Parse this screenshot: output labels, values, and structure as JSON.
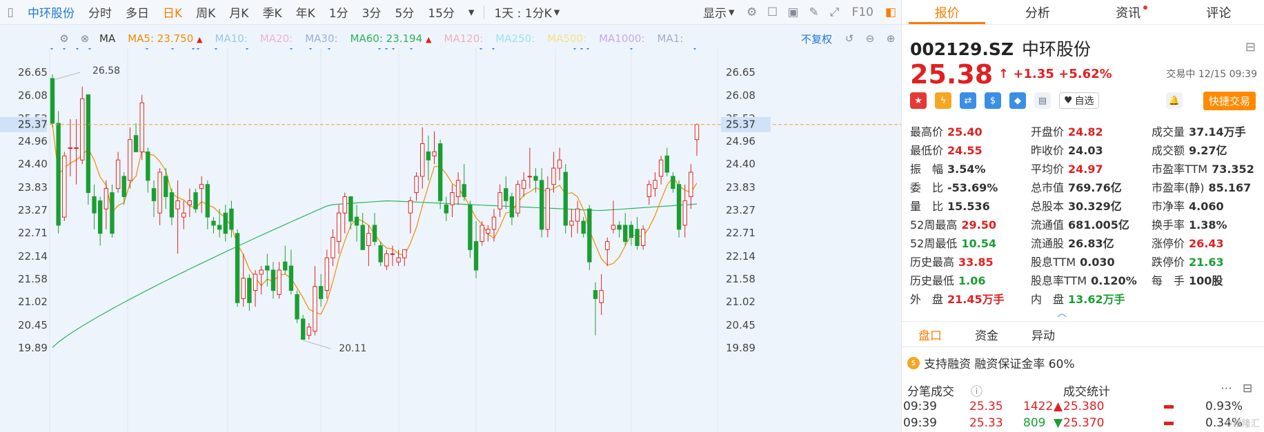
{
  "toolbar": {
    "stock_name": "中环股份",
    "periods": [
      "分时",
      "多日",
      "日K",
      "周K",
      "月K",
      "季K",
      "年K",
      "1分",
      "3分",
      "5分",
      "15分"
    ],
    "active_period": "日K",
    "multi_view": "1天 : 1分K",
    "display": "显示",
    "f10": "F10"
  },
  "ma_bar": {
    "ma_label": "MA",
    "ma5": "MA5: 23.750",
    "ma10": "MA10:",
    "ma20": "MA20:",
    "ma30": "MA30:",
    "ma60": "MA60: 23.194",
    "ma120": "MA120:",
    "ma250": "MA250:",
    "ma500": "MA500:",
    "ma1000": "MA1000:",
    "ma1": "MA1:",
    "adjust": "不复权"
  },
  "chart_data": {
    "type": "candlestick",
    "y_ticks": [
      "26.65",
      "26.08",
      "25.52",
      "24.96",
      "24.40",
      "23.83",
      "23.27",
      "22.71",
      "22.14",
      "21.58",
      "21.02",
      "20.45",
      "19.89"
    ],
    "y_range": [
      19.89,
      26.65
    ],
    "current_price_label": "25.37",
    "max_label": "26.58",
    "min_label": "20.11",
    "candles": [
      [
        26.5,
        26.6,
        25.3,
        25.4
      ],
      [
        25.4,
        25.7,
        22.7,
        22.9
      ],
      [
        23.1,
        24.7,
        23.0,
        24.6
      ],
      [
        24.8,
        25.5,
        24.1,
        24.8
      ],
      [
        24.8,
        25.5,
        23.9,
        24.8
      ],
      [
        24.5,
        26.3,
        24.4,
        26.0
      ],
      [
        26.1,
        26.1,
        23.4,
        23.7
      ],
      [
        23.6,
        23.9,
        22.8,
        23.2
      ],
      [
        23.5,
        23.6,
        22.4,
        22.7
      ],
      [
        23.3,
        24.0,
        22.8,
        23.8
      ],
      [
        23.7,
        23.9,
        22.6,
        22.7
      ],
      [
        23.8,
        24.7,
        23.7,
        24.5
      ],
      [
        24.1,
        24.2,
        23.4,
        23.6
      ],
      [
        24.0,
        25.3,
        23.8,
        25.0
      ],
      [
        25.1,
        25.4,
        24.8,
        24.7
      ],
      [
        24.7,
        26.1,
        24.5,
        25.9
      ],
      [
        24.7,
        24.8,
        23.7,
        24.0
      ],
      [
        23.8,
        24.0,
        23.1,
        23.5
      ],
      [
        23.2,
        24.3,
        22.9,
        24.2
      ],
      [
        24.1,
        24.3,
        23.3,
        23.6
      ],
      [
        23.7,
        23.8,
        22.9,
        23.1
      ],
      [
        23.3,
        24.0,
        22.2,
        23.5
      ],
      [
        23.1,
        23.5,
        22.8,
        23.2
      ],
      [
        23.4,
        23.8,
        23.1,
        23.5
      ],
      [
        23.7,
        23.8,
        23.2,
        23.3
      ],
      [
        23.8,
        24.1,
        23.2,
        23.9
      ],
      [
        23.9,
        24.0,
        22.8,
        23.1
      ],
      [
        23.0,
        23.1,
        22.7,
        22.9
      ],
      [
        22.9,
        23.3,
        22.6,
        22.8
      ],
      [
        23.2,
        23.4,
        22.5,
        22.7
      ],
      [
        23.3,
        23.5,
        22.6,
        22.8
      ],
      [
        22.7,
        22.8,
        20.9,
        21.0
      ],
      [
        21.1,
        22.2,
        20.9,
        21.6
      ],
      [
        21.6,
        21.7,
        20.8,
        21.0
      ],
      [
        21.3,
        21.8,
        20.9,
        21.7
      ],
      [
        21.7,
        21.9,
        21.2,
        21.8
      ],
      [
        21.9,
        22.2,
        21.4,
        21.8
      ],
      [
        21.8,
        22.0,
        21.1,
        21.3
      ],
      [
        21.2,
        22.0,
        21.1,
        21.8
      ],
      [
        22.0,
        22.4,
        21.7,
        21.8
      ],
      [
        21.9,
        22.3,
        21.2,
        21.3
      ],
      [
        21.2,
        21.3,
        20.5,
        20.6
      ],
      [
        20.6,
        20.7,
        20.1,
        20.1
      ],
      [
        20.2,
        20.5,
        20.1,
        20.4
      ],
      [
        20.3,
        21.9,
        20.2,
        21.4
      ],
      [
        21.4,
        21.7,
        20.9,
        21.1
      ],
      [
        21.3,
        22.3,
        21.1,
        22.1
      ],
      [
        22.1,
        22.8,
        21.9,
        22.6
      ],
      [
        22.5,
        23.4,
        22.2,
        23.2
      ],
      [
        23.2,
        23.7,
        22.7,
        23.6
      ],
      [
        23.6,
        23.6,
        22.8,
        23.0
      ],
      [
        23.1,
        23.4,
        22.5,
        22.9
      ],
      [
        22.9,
        23.2,
        22.3,
        22.3
      ],
      [
        22.4,
        22.9,
        21.9,
        22.7
      ],
      [
        22.9,
        23.2,
        22.4,
        22.5
      ],
      [
        22.4,
        22.5,
        21.9,
        22.0
      ],
      [
        21.9,
        22.3,
        21.8,
        22.2
      ],
      [
        22.2,
        22.4,
        21.9,
        22.2
      ],
      [
        22.0,
        22.3,
        21.9,
        22.1
      ],
      [
        22.1,
        22.3,
        21.9,
        22.3
      ],
      [
        23.2,
        23.6,
        22.7,
        23.5
      ],
      [
        23.7,
        24.2,
        23.5,
        24.1
      ],
      [
        24.1,
        25.3,
        23.8,
        24.9
      ],
      [
        24.7,
        25.1,
        24.0,
        24.5
      ],
      [
        24.6,
        25.2,
        24.4,
        24.7
      ],
      [
        24.9,
        25.0,
        23.3,
        23.5
      ],
      [
        23.4,
        23.6,
        23.0,
        23.2
      ],
      [
        23.4,
        23.9,
        23.1,
        23.7
      ],
      [
        23.6,
        24.2,
        23.4,
        24.0
      ],
      [
        23.9,
        24.4,
        23.5,
        23.6
      ],
      [
        23.4,
        23.5,
        22.1,
        22.3
      ],
      [
        22.5,
        23.0,
        21.6,
        21.8
      ],
      [
        22.5,
        23.0,
        22.4,
        22.9
      ],
      [
        22.7,
        22.9,
        22.5,
        22.8
      ],
      [
        22.8,
        23.3,
        22.5,
        23.1
      ],
      [
        23.3,
        23.9,
        23.1,
        23.7
      ],
      [
        23.8,
        24.1,
        23.3,
        23.5
      ],
      [
        23.6,
        23.7,
        22.9,
        23.1
      ],
      [
        23.2,
        24.0,
        23.1,
        23.9
      ],
      [
        23.8,
        24.2,
        23.6,
        24.0
      ],
      [
        24.1,
        24.8,
        23.8,
        24.1
      ],
      [
        24.1,
        24.3,
        23.7,
        24.0
      ],
      [
        24.0,
        24.3,
        22.6,
        22.8
      ],
      [
        22.8,
        24.1,
        22.6,
        23.8
      ],
      [
        23.9,
        24.7,
        23.7,
        24.3
      ],
      [
        24.3,
        24.8,
        24.0,
        24.5
      ],
      [
        24.2,
        24.4,
        22.7,
        22.9
      ],
      [
        22.9,
        23.3,
        22.6,
        23.0
      ],
      [
        23.0,
        23.5,
        22.7,
        23.3
      ],
      [
        23.0,
        23.1,
        22.6,
        22.7
      ],
      [
        23.3,
        23.4,
        21.8,
        22.0
      ],
      [
        21.3,
        21.5,
        20.2,
        21.1
      ],
      [
        21.0,
        21.7,
        20.7,
        21.3
      ],
      [
        22.3,
        22.6,
        21.9,
        22.5
      ],
      [
        22.8,
        23.5,
        22.7,
        22.9
      ],
      [
        22.9,
        23.0,
        22.6,
        22.8
      ],
      [
        22.9,
        23.2,
        22.4,
        22.5
      ],
      [
        22.9,
        23.0,
        22.4,
        22.6
      ],
      [
        22.8,
        23.1,
        22.3,
        22.4
      ],
      [
        22.4,
        22.9,
        22.3,
        22.8
      ],
      [
        23.6,
        24.0,
        23.4,
        23.9
      ],
      [
        23.8,
        24.2,
        23.6,
        24.0
      ],
      [
        24.1,
        24.6,
        23.9,
        24.5
      ],
      [
        24.6,
        24.8,
        24.1,
        24.2
      ],
      [
        24.1,
        24.2,
        23.7,
        23.8
      ],
      [
        23.9,
        24.0,
        22.6,
        22.8
      ],
      [
        22.9,
        23.9,
        22.6,
        23.5
      ],
      [
        23.6,
        24.4,
        23.3,
        24.2
      ],
      [
        25.0,
        25.4,
        24.6,
        25.37
      ]
    ],
    "ma5_color": "#f08c00",
    "ma60_color": "#2db35d",
    "up_color": "#e02020",
    "down_color": "#1a9e33"
  },
  "quote": {
    "code": "002129.SZ",
    "name": "中环股份",
    "price": "25.38",
    "arrow": "↑",
    "change": "+1.35",
    "change_pct": "+5.62%",
    "trade_status": "交易中 12/15 09:39",
    "fav_label": "自选",
    "quick_trade": "快捷交易"
  },
  "stats": [
    [
      {
        "k": "最高价",
        "v": "25.40",
        "c": "red"
      },
      {
        "k": "开盘价",
        "v": "24.82",
        "c": "red"
      },
      {
        "k": "成交量",
        "v": "37.14万手",
        "c": "dark"
      }
    ],
    [
      {
        "k": "最低价",
        "v": "24.55",
        "c": "red"
      },
      {
        "k": "昨收价",
        "v": "24.03",
        "c": "dark"
      },
      {
        "k": "成交额",
        "v": "9.27亿",
        "c": "dark"
      }
    ],
    [
      {
        "k": "振　幅",
        "v": "3.54%",
        "c": "dark"
      },
      {
        "k": "平均价",
        "v": "24.97",
        "c": "red"
      },
      {
        "k": "市盈率TTM",
        "v": "73.352",
        "c": "dark"
      }
    ],
    [
      {
        "k": "委　比",
        "v": "-53.69%",
        "c": "dark"
      },
      {
        "k": "总市值",
        "v": "769.76亿",
        "c": "dark"
      },
      {
        "k": "市盈率(静)",
        "v": "85.167",
        "c": "dark"
      }
    ],
    [
      {
        "k": "量　比",
        "v": "15.536",
        "c": "dark"
      },
      {
        "k": "总股本",
        "v": "30.329亿",
        "c": "dark"
      },
      {
        "k": "市净率",
        "v": "4.060",
        "c": "dark"
      }
    ],
    [
      {
        "k": "52周最高",
        "v": "29.50",
        "c": "red"
      },
      {
        "k": "流通值",
        "v": "681.005亿",
        "c": "dark"
      },
      {
        "k": "换手率",
        "v": "1.38%",
        "c": "dark"
      }
    ],
    [
      {
        "k": "52周最低",
        "v": "10.54",
        "c": "green"
      },
      {
        "k": "流通股",
        "v": "26.83亿",
        "c": "dark"
      },
      {
        "k": "涨停价",
        "v": "26.43",
        "c": "red"
      }
    ],
    [
      {
        "k": "历史最高",
        "v": "33.85",
        "c": "red"
      },
      {
        "k": "股息TTM",
        "v": "0.030",
        "c": "dark"
      },
      {
        "k": "跌停价",
        "v": "21.63",
        "c": "green"
      }
    ],
    [
      {
        "k": "历史最低",
        "v": "1.06",
        "c": "green"
      },
      {
        "k": "股息率TTM",
        "v": "0.120%",
        "c": "dark"
      },
      {
        "k": "每　手",
        "v": "100股",
        "c": "dark"
      }
    ],
    [
      {
        "k": "外　盘",
        "v": "21.45万手",
        "c": "red"
      },
      {
        "k": "内　盘",
        "v": "13.62万手",
        "c": "green"
      },
      {
        "k": "",
        "v": "",
        "c": "dark"
      }
    ]
  ],
  "right_tabs": [
    "报价",
    "分析",
    "资讯",
    "评论"
  ],
  "panel_tabs": [
    "盘口",
    "资金",
    "异动"
  ],
  "margin_text": "支持融资 融资保证金率 60%",
  "tick_title": "分笔成交",
  "deal_title": "成交统计",
  "ticks": [
    {
      "time": "09:39",
      "price": "25.35",
      "vol": "1422",
      "dir": "▲"
    },
    {
      "time": "09:39",
      "price": "25.33",
      "vol": "809",
      "dir": "▼"
    }
  ],
  "deal_stats": [
    {
      "price": "25.380",
      "pct": "0.93%"
    },
    {
      "price": "25.370",
      "pct": "0.34%"
    }
  ],
  "watermark": "格隆汇"
}
